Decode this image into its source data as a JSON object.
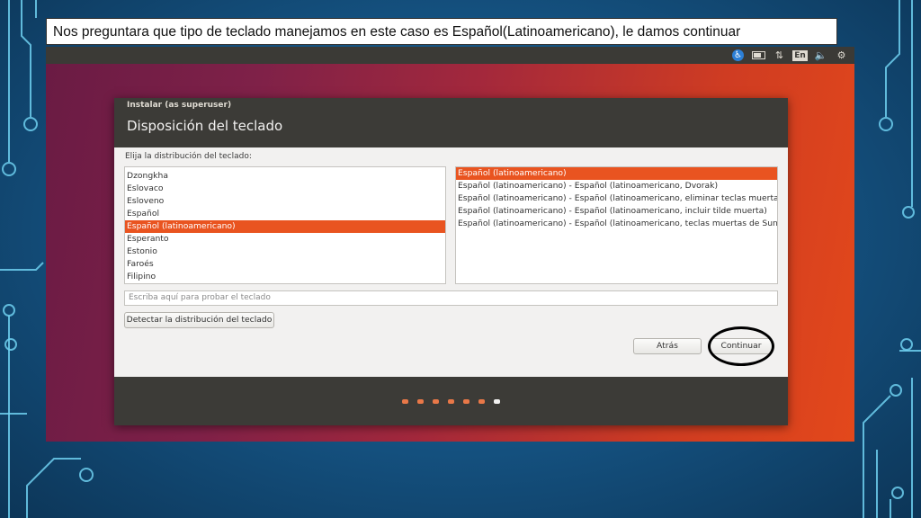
{
  "caption": "Nos preguntara que tipo de teclado manejamos en este caso es Español(Latinoamericano), le damos continuar",
  "topbar": {
    "icons": [
      "accessibility-icon",
      "battery-icon",
      "network-icon",
      "keyboard-language-indicator",
      "volume-icon",
      "settings-gear-icon"
    ],
    "language": "En"
  },
  "window": {
    "title": "Instalar (as superuser)",
    "header": "Disposición del teclado",
    "list_label": "Elija la distribución del teclado:",
    "layouts": [
      "Dzongkha",
      "Eslovaco",
      "Esloveno",
      "Español",
      "Español (latinoamericano)",
      "Esperanto",
      "Estonio",
      "Faroés",
      "Filipino"
    ],
    "selected_layout": "Español (latinoamericano)",
    "variants": [
      "Español (latinoamericano)",
      "Español (latinoamericano) - Español (latinoamericano, Dvorak)",
      "Español (latinoamericano) - Español (latinoamericano, eliminar teclas muertas)",
      "Español (latinoamericano) - Español (latinoamericano, incluir tilde muerta)",
      "Español (latinoamericano) - Español (latinoamericano, teclas muertas de Sun)"
    ],
    "selected_variant": "Español (latinoamericano)",
    "test_placeholder": "Escriba aquí para probar el teclado",
    "detect_button": "Detectar la distribución del teclado",
    "back_button": "Atrás",
    "continue_button": "Continuar",
    "progress": {
      "steps_total": 7,
      "current_step": 7
    }
  },
  "colors": {
    "accent": "#e95420",
    "window_chrome": "#3c3b37"
  }
}
